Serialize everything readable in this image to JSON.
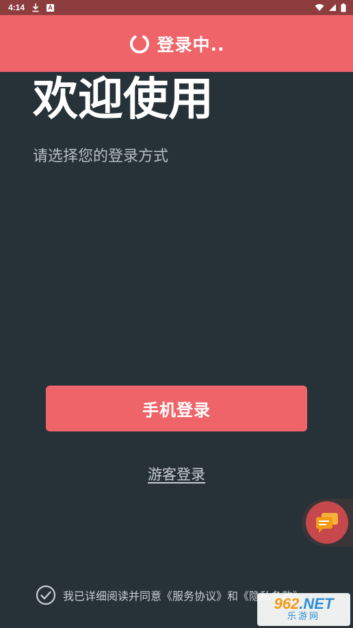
{
  "status_bar": {
    "time": "4:14",
    "icons": [
      "download-icon",
      "a-icon",
      "wifi-icon",
      "signal-icon",
      "battery-icon"
    ]
  },
  "header": {
    "title": "登录中..",
    "icon": "spinner-icon",
    "color": "#ee6468"
  },
  "welcome": {
    "title": "欢迎使用",
    "subtitle": "请选择您的登录方式"
  },
  "actions": {
    "phone_login_label": "手机登录",
    "guest_login_label": "游客登录"
  },
  "float_button": {
    "icon": "chat-bubble-icon"
  },
  "agreement": {
    "text": "我已详细阅读并同意《服务协议》和《隐私条款》"
  },
  "watermark": {
    "brand_number": "962",
    "brand_suffix": ".NET",
    "brand_name": "乐游网"
  },
  "colors": {
    "background": "#263238",
    "accent": "#ee6468",
    "status_bar": "#8e3d3f"
  }
}
